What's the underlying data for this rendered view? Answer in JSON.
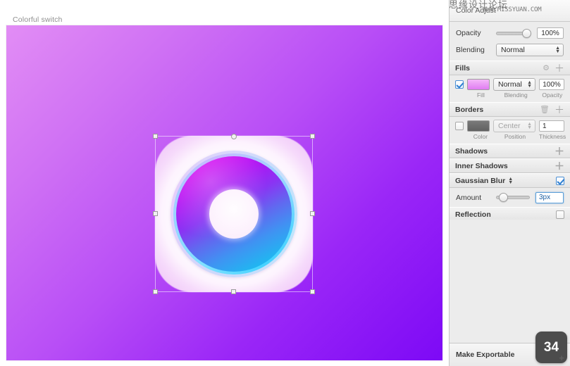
{
  "canvas": {
    "artboard_label": "Colorful switch",
    "background_gradient_from": "#e28df5",
    "background_gradient_to": "#7d09f6",
    "artwork": {
      "name": "rounded-square-ring-icon",
      "ring_gradient_from": "#e800f0",
      "ring_gradient_mid": "#6168f0",
      "ring_gradient_to": "#12c6f0",
      "ring_outline_color": "#45d2ff",
      "plate_color": "#ffffff",
      "center_color": "#fdf2fd"
    }
  },
  "inspector": {
    "header_title": "Color Adjust",
    "watermark_cn": "思缘设计论坛",
    "watermark_url": "WWW.MISSYUAN.COM",
    "opacity": {
      "label": "Opacity",
      "value": "100%",
      "slider_percent": 100
    },
    "blending": {
      "label": "Blending",
      "value": "Normal"
    },
    "fills": {
      "title": "Fills",
      "enabled": true,
      "fill_color": "#ef9cf5",
      "blending": "Normal",
      "opacity": "100%",
      "captions": {
        "fill": "Fill",
        "blending": "Blending",
        "opacity": "Opacity"
      },
      "gear_icon": "gear-icon",
      "add_icon": "plus-icon"
    },
    "borders": {
      "title": "Borders",
      "enabled": false,
      "color": "#6d6d6d",
      "position": "Center",
      "thickness": "1",
      "captions": {
        "color": "Color",
        "position": "Position",
        "thickness": "Thickness"
      },
      "delete_icon": "trash-icon",
      "add_icon": "plus-icon"
    },
    "shadows": {
      "title": "Shadows",
      "add_icon": "plus-icon"
    },
    "inner_shadows": {
      "title": "Inner Shadows",
      "add_icon": "plus-icon"
    },
    "gaussian_blur": {
      "title": "Gaussian Blur",
      "enabled": true,
      "stepper_icon": "up-down-stepper-icon",
      "amount_label": "Amount",
      "amount_value": "3px",
      "amount_slider_percent": 10
    },
    "reflection": {
      "title": "Reflection",
      "enabled": false
    },
    "make_exportable": {
      "label": "Make Exportable"
    }
  },
  "badge": {
    "count": "34",
    "plus": "+"
  }
}
